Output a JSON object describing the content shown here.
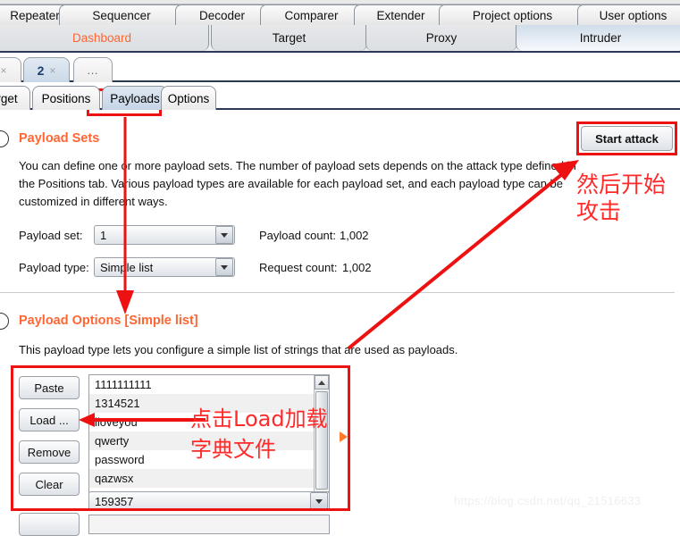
{
  "window": {
    "main_tabs_row1": [
      {
        "label": "Repeater"
      },
      {
        "label": "Sequencer"
      },
      {
        "label": "Decoder"
      },
      {
        "label": "Comparer"
      },
      {
        "label": "Extender"
      },
      {
        "label": "Project options"
      },
      {
        "label": "User options"
      }
    ],
    "main_tabs_row2": [
      {
        "label": "Dashboard",
        "state": "alert"
      },
      {
        "label": "Target",
        "state": "normal"
      },
      {
        "label": "Proxy",
        "state": "normal"
      },
      {
        "label": "Intruder",
        "state": "selected"
      }
    ],
    "attack_tabs": [
      {
        "label": "",
        "close": "×"
      },
      {
        "label": "2",
        "close": "×"
      },
      {
        "label": "…"
      }
    ],
    "sub_tabs": [
      {
        "label": "rget"
      },
      {
        "label": "Positions"
      },
      {
        "label": "Payloads"
      },
      {
        "label": "Options"
      }
    ]
  },
  "payload_sets": {
    "title": "Payload Sets",
    "description_line1": "You can define one or more payload sets. The number of payload sets depends on the attack type defined in",
    "description_line2": "the Positions tab. Various payload types are available for each payload set, and each payload type can be",
    "description_line3": "customized in different ways.",
    "payload_set_label": "Payload set:",
    "payload_set_value": "1",
    "payload_type_label": "Payload type:",
    "payload_type_value": "Simple list",
    "payload_count_label": "Payload count:",
    "payload_count_value": "1,002",
    "request_count_label": "Request count:",
    "request_count_value": "1,002",
    "start_attack_label": "Start attack"
  },
  "payload_options": {
    "title": "Payload Options [Simple list]",
    "description": "This payload type lets you configure a simple list of strings that are used as payloads.",
    "buttons": [
      {
        "label": "Paste"
      },
      {
        "label": "Load ..."
      },
      {
        "label": "Remove"
      },
      {
        "label": "Clear"
      }
    ],
    "list_items": [
      "1111111111",
      "1314521",
      "iloveyou",
      "qwerty",
      "password",
      "qazwsx",
      "159357"
    ],
    "add_value": "159357"
  },
  "annotations": {
    "start_attack_note": "然后开始\n攻击",
    "load_note": "点击Load加载\n字典文件",
    "watermark": "https://blog.csdn.net/qq_21516633"
  },
  "colors": {
    "accent_orange": "#ff6633",
    "annotation_red": "#ee1111",
    "selected_tab_blue": "#c9d8e8"
  }
}
